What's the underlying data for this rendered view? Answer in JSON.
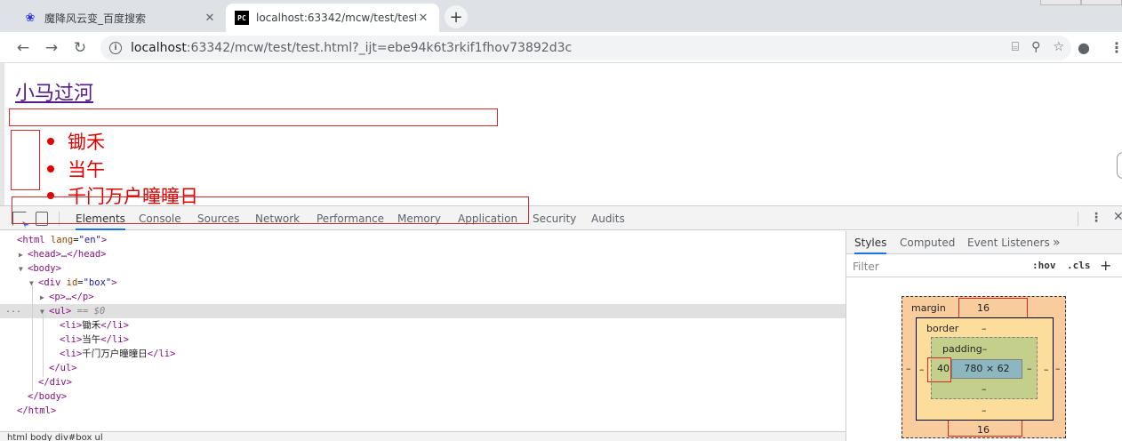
{
  "tabs": [
    {
      "title": "魔降风云变_百度搜索",
      "icon": "baidu-paw-icon",
      "active": false
    },
    {
      "title": "localhost:63342/mcw/test/test",
      "icon": "pycharm-icon",
      "active": true
    }
  ],
  "new_tab_label": "+",
  "address_bar": {
    "host": "localhost",
    "rest": ":63342/mcw/test/test.html?_ijt=ebe94k6t3rkif1fhov73892d3c"
  },
  "page": {
    "link_text": "小马过河",
    "list_items": [
      "锄禾",
      "当午",
      "千门万户曈曈日"
    ]
  },
  "devtools": {
    "tabs": [
      "Elements",
      "Console",
      "Sources",
      "Network",
      "Performance",
      "Memory",
      "Application",
      "Security",
      "Audits"
    ],
    "active_tab": "Elements",
    "dom": {
      "html_open": "<html",
      "lang_attr": "lang",
      "lang_val": "\"en\"",
      "head": "<head>…</head>",
      "body_open": "<body>",
      "div_open_tag": "<div",
      "div_attr": "id",
      "div_val": "\"box\"",
      "div_close_bracket": ">",
      "p_collapsed": "<p>…</p>",
      "ul_open": "<ul>",
      "selected_marker": "== $0",
      "li_open": "<li>",
      "li_close": "</li>",
      "ul_close": "</ul>",
      "div_close": "</div>",
      "body_close": "</body>",
      "html_close": "</html>",
      "gt": ">",
      "dots": "..."
    },
    "sidebar_tabs": [
      "Styles",
      "Computed",
      "Event Listeners"
    ],
    "sidebar_more": "»",
    "filter_placeholder": "Filter",
    "hov_label": ":hov",
    "cls_label": ".cls",
    "plus_label": "+",
    "box_model": {
      "margin_label": "margin",
      "margin_top": "16",
      "margin_bottom": "16",
      "margin_side": "–",
      "border_label": "border",
      "border_value": "–",
      "padding_label": "padding–",
      "padding_left": "40",
      "padding_right": "–",
      "padding_bottom": "–",
      "content_size": "780 × 62"
    },
    "breadcrumb_partial": "html body div#box ul"
  }
}
